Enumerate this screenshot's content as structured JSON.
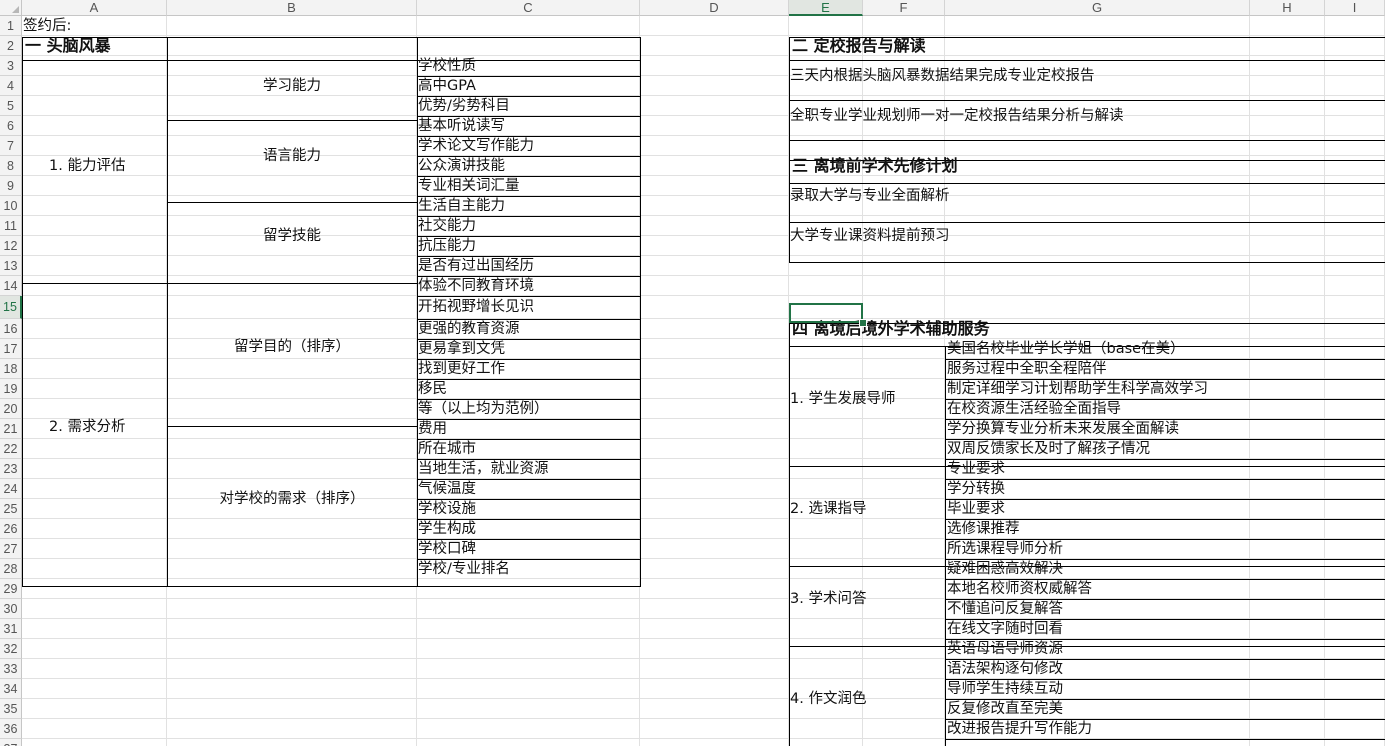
{
  "headers": {
    "columns": [
      "A",
      "B",
      "C",
      "D",
      "E",
      "F",
      "G",
      "H",
      "I"
    ],
    "selected_column": "E",
    "rows": [
      "1",
      "2",
      "3",
      "4",
      "5",
      "6",
      "7",
      "8",
      "9",
      "10",
      "11",
      "12",
      "13",
      "14",
      "15",
      "16",
      "17",
      "18",
      "19",
      "20",
      "21",
      "22",
      "23",
      "24",
      "25",
      "26",
      "27",
      "28",
      "29",
      "30",
      "31",
      "32",
      "33",
      "34",
      "35",
      "36",
      "37"
    ],
    "selected_row": "15"
  },
  "colors": {
    "accent": "#217346",
    "gridline": "#e1e1e1",
    "border": "#000000"
  },
  "cells": {
    "A1": "签约后:",
    "A2": "一  头脑风暴",
    "A_ability": "1. 能力评估",
    "A_needs": "2. 需求分析",
    "B_study": "学习能力",
    "B_lang": "语言能力",
    "B_abroad": "留学技能",
    "B_purpose": "留学目的（排序）",
    "B_school": "对学校的需求（排序）",
    "C_items": [
      "学校性质",
      "高中GPA",
      "优势/劣势科目",
      "基本听说读写",
      "学术论文写作能力",
      "公众演讲技能",
      "专业相关词汇量",
      "生活自主能力",
      "社交能力",
      "抗压能力",
      "是否有过出国经历",
      "体验不同教育环境",
      "开拓视野增长见识",
      "更强的教育资源",
      "更易拿到文凭",
      "找到更好工作",
      "移民",
      "等（以上均为范例）",
      "费用",
      "所在城市",
      "当地生活，就业资源",
      "气候温度",
      "学校设施",
      "学生构成",
      "学校口碑",
      "学校/专业排名"
    ],
    "E2": "二  定校报告与解读",
    "E3": "三天内根据头脑风暴数据结果完成专业定校报告",
    "E5": "全职专业学业规划师一对一定校报告结果分析与解读",
    "E8": "三  离境前学术先修计划",
    "E9": "录取大学与专业全面解析",
    "E11": "大学专业课资料提前预习",
    "E16": "四  离境后境外学术辅助服务",
    "E_mentor": "1. 学生发展导师",
    "E_course": "2. 选课指导",
    "E_qa": "3. 学术问答",
    "E_essay": "4. 作文润色",
    "G_items": [
      "美国名校毕业学长学姐（base在美）",
      "服务过程中全职全程陪伴",
      "制定详细学习计划帮助学生科学高效学习",
      "在校资源生活经验全面指导",
      "学分换算专业分析未来发展全面解读",
      "双周反馈家长及时了解孩子情况",
      "专业要求",
      "学分转换",
      "毕业要求",
      "选修课推荐",
      "所选课程导师分析",
      "疑难困惑高效解决",
      "本地名校师资权威解答",
      "不懂追问反复解答",
      "在线文字随时回看",
      "英语母语导师资源",
      "语法架构逐句修改",
      "导师学生持续互动",
      "反复修改直至完美",
      "改进报告提升写作能力"
    ]
  }
}
